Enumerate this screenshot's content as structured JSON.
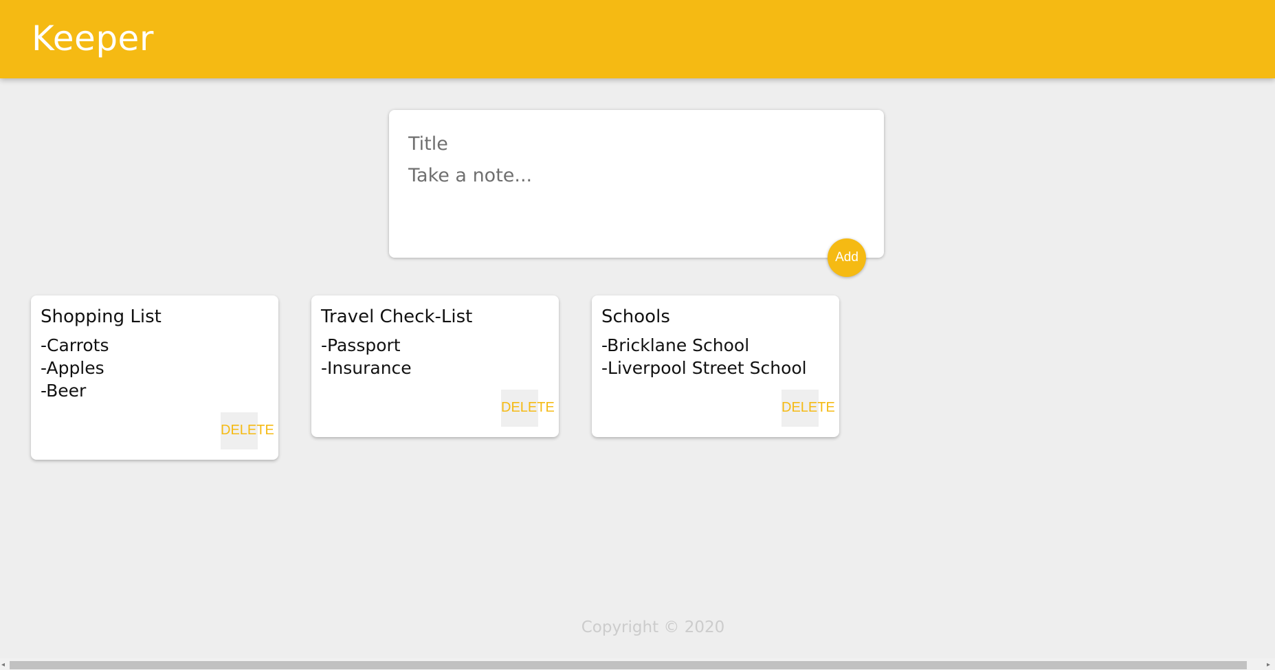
{
  "header": {
    "brand": "Keeper",
    "color": "#f5ba13"
  },
  "composer": {
    "title_placeholder": "Title",
    "content_placeholder": "Take a note...",
    "add_label": "Add"
  },
  "notes": [
    {
      "title": "Shopping List",
      "content": "-Carrots\n-Apples\n-Beer",
      "delete_label": "DELETE"
    },
    {
      "title": "Travel Check-List",
      "content": "-Passport\n-Insurance",
      "delete_label": "DELETE"
    },
    {
      "title": "Schools",
      "content": "-Bricklane School\n-Liverpool Street School",
      "delete_label": "DELETE"
    }
  ],
  "footer": {
    "copyright": "Copyright © 2020"
  },
  "scrollbar": {
    "left_arrow_icon": "◂",
    "right_arrow_icon": "▸"
  }
}
